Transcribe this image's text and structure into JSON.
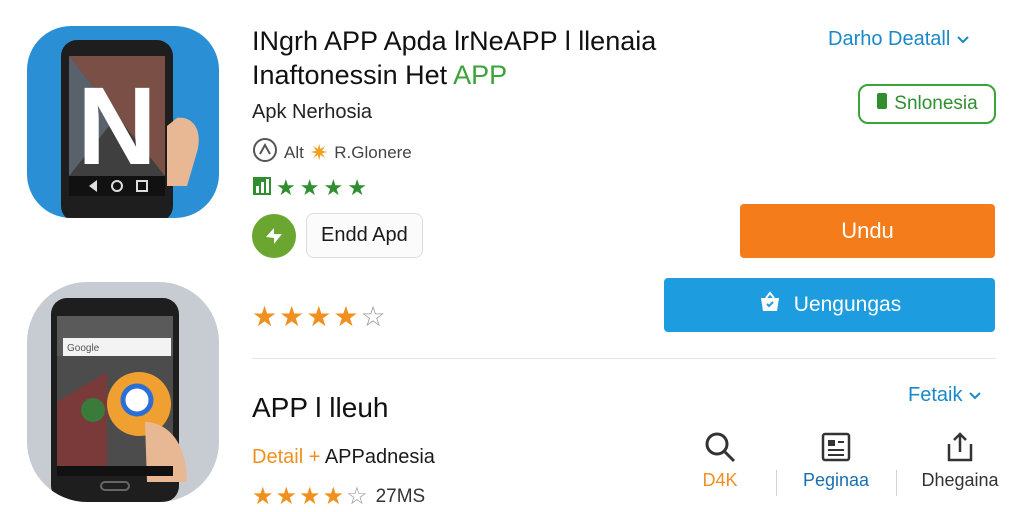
{
  "app1": {
    "title_line1": "INgrh APP Apda lrNeAPP l llenaia",
    "title_line2_black": "Inaftonessin Het ",
    "title_line2_green": "APP",
    "subtitle": "Apk Nerhosia",
    "meta_text": "Alt",
    "meta_region": "R.Glonere",
    "chip_label": "Endd Apd",
    "detail_link": "Darho Deatall",
    "badge_label": "Snlonesia",
    "primary_button": "Undu",
    "secondary_button": "Uengungas",
    "rating_green": 4,
    "rating_orange": 4
  },
  "app2": {
    "title": "APP l lleuh",
    "detail_link": "Fetaik",
    "detail_prefix": "Detail",
    "detail_separator": " + ",
    "detail_suffix": "APPadnesia",
    "size": "27MS",
    "rating": 3.5,
    "screen_search": "Google",
    "actions": [
      {
        "label": "D4K",
        "icon": "search-icon",
        "color": "#f0901f"
      },
      {
        "label": "Peginaa",
        "icon": "document-icon",
        "color": "#1a6fb0"
      },
      {
        "label": "Dhegaina",
        "icon": "share-icon",
        "color": "#333333"
      }
    ]
  },
  "colors": {
    "orange": "#f47c1b",
    "blue": "#1d9de0",
    "green": "#3aa33a",
    "link": "#1a88c9"
  }
}
